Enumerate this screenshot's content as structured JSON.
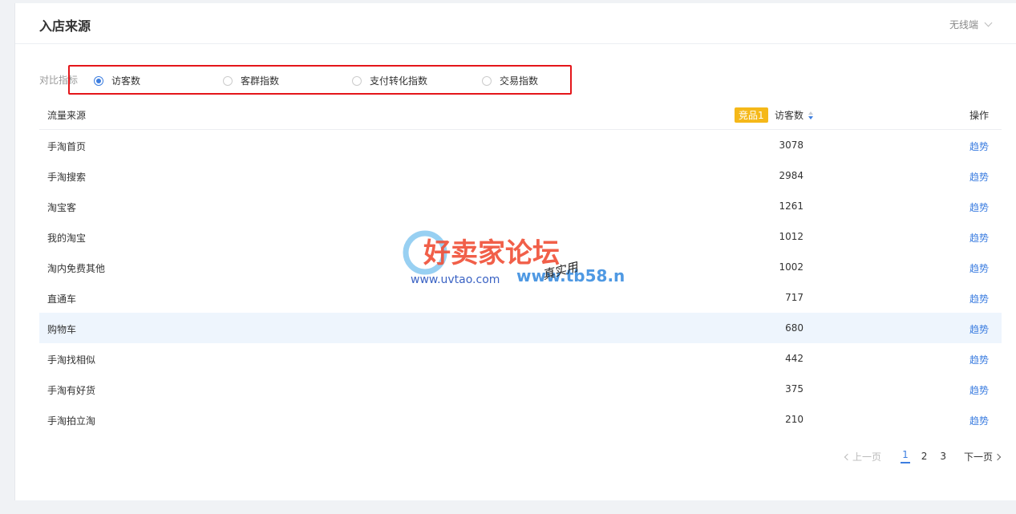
{
  "header": {
    "title": "入店来源",
    "device": "无线端"
  },
  "compare": {
    "label": "对比指标",
    "options": [
      {
        "label": "访客数",
        "checked": true
      },
      {
        "label": "客群指数",
        "checked": false
      },
      {
        "label": "支付转化指数",
        "checked": false
      },
      {
        "label": "交易指数",
        "checked": false
      }
    ]
  },
  "table": {
    "col_source": "流量来源",
    "badge": "竞品1",
    "col_visitors": "访客数",
    "col_action": "操作",
    "rows": [
      {
        "source": "手淘首页",
        "visitors": "3078",
        "action": "趋势"
      },
      {
        "source": "手淘搜索",
        "visitors": "2984",
        "action": "趋势"
      },
      {
        "source": "淘宝客",
        "visitors": "1261",
        "action": "趋势"
      },
      {
        "source": "我的淘宝",
        "visitors": "1012",
        "action": "趋势"
      },
      {
        "source": "淘内免费其他",
        "visitors": "1002",
        "action": "趋势"
      },
      {
        "source": "直通车",
        "visitors": "717",
        "action": "趋势"
      },
      {
        "source": "购物车",
        "visitors": "680",
        "action": "趋势"
      },
      {
        "source": "手淘找相似",
        "visitors": "442",
        "action": "趋势"
      },
      {
        "source": "手淘有好货",
        "visitors": "375",
        "action": "趋势"
      },
      {
        "source": "手淘拍立淘",
        "visitors": "210",
        "action": "趋势"
      }
    ]
  },
  "pager": {
    "prev": "上一页",
    "pages": [
      "1",
      "2",
      "3"
    ],
    "current": "1",
    "next": "下一页"
  },
  "watermark": {
    "main": "好卖家论坛",
    "url1": "www.uvtao.com",
    "url2": "www.tb58.net",
    "sig": "真实用"
  },
  "colors": {
    "accent": "#3d7ee0",
    "badge": "#f5b819",
    "highlight": "#e4161a",
    "hover_row": "#eef5fd"
  }
}
